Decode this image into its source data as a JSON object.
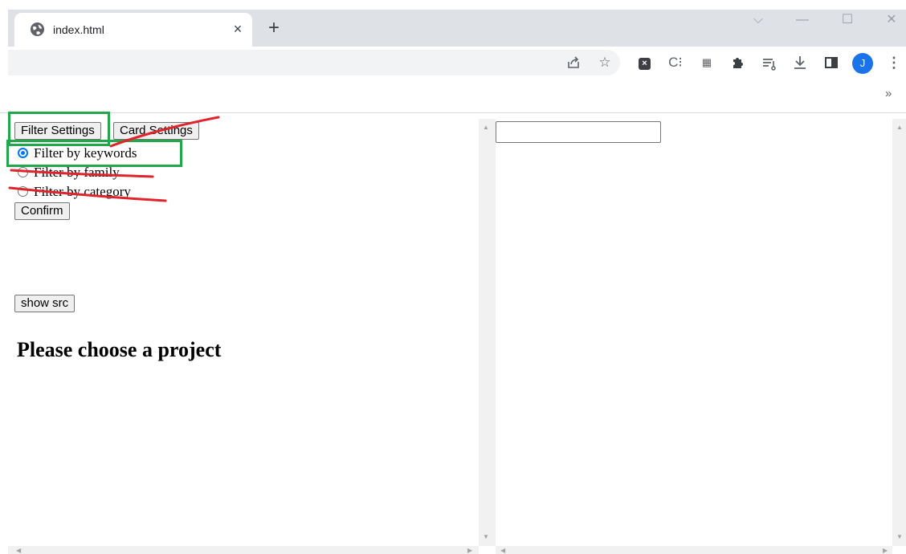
{
  "browser": {
    "tab": {
      "title": "index.html",
      "close_glyph": "×"
    },
    "new_tab_glyph": "+",
    "window_controls": {
      "dropdown": "⌵",
      "minimize": "—",
      "maximize": "☐",
      "close": "✕"
    },
    "toolbar_icons": [
      "share-icon",
      "star-icon",
      "extension-x-icon",
      "extension-c-icon",
      "extension-sheet-icon",
      "puzzle-icon",
      "reading-list-icon",
      "download-icon",
      "side-panel-icon"
    ],
    "profile_initial": "J",
    "more_glyph": "⋮",
    "bookmarks_more": "»"
  },
  "page": {
    "buttons": {
      "filter_settings": "Filter Settings",
      "card_settings": "Card Settings",
      "confirm": "Confirm",
      "show_src": "show src"
    },
    "radio_options": [
      {
        "label": "Filter by keywords",
        "checked": true
      },
      {
        "label": "Filter by family",
        "checked": false
      },
      {
        "label": "Filter by category",
        "checked": false
      }
    ],
    "heading": "Please choose a project",
    "right_input": {
      "value": "",
      "placeholder": ""
    }
  },
  "colors": {
    "annotation_green": "#22a84a",
    "annotation_red": "#e0242c",
    "radio_accent": "#0075ff",
    "avatar": "#1a73e8"
  }
}
